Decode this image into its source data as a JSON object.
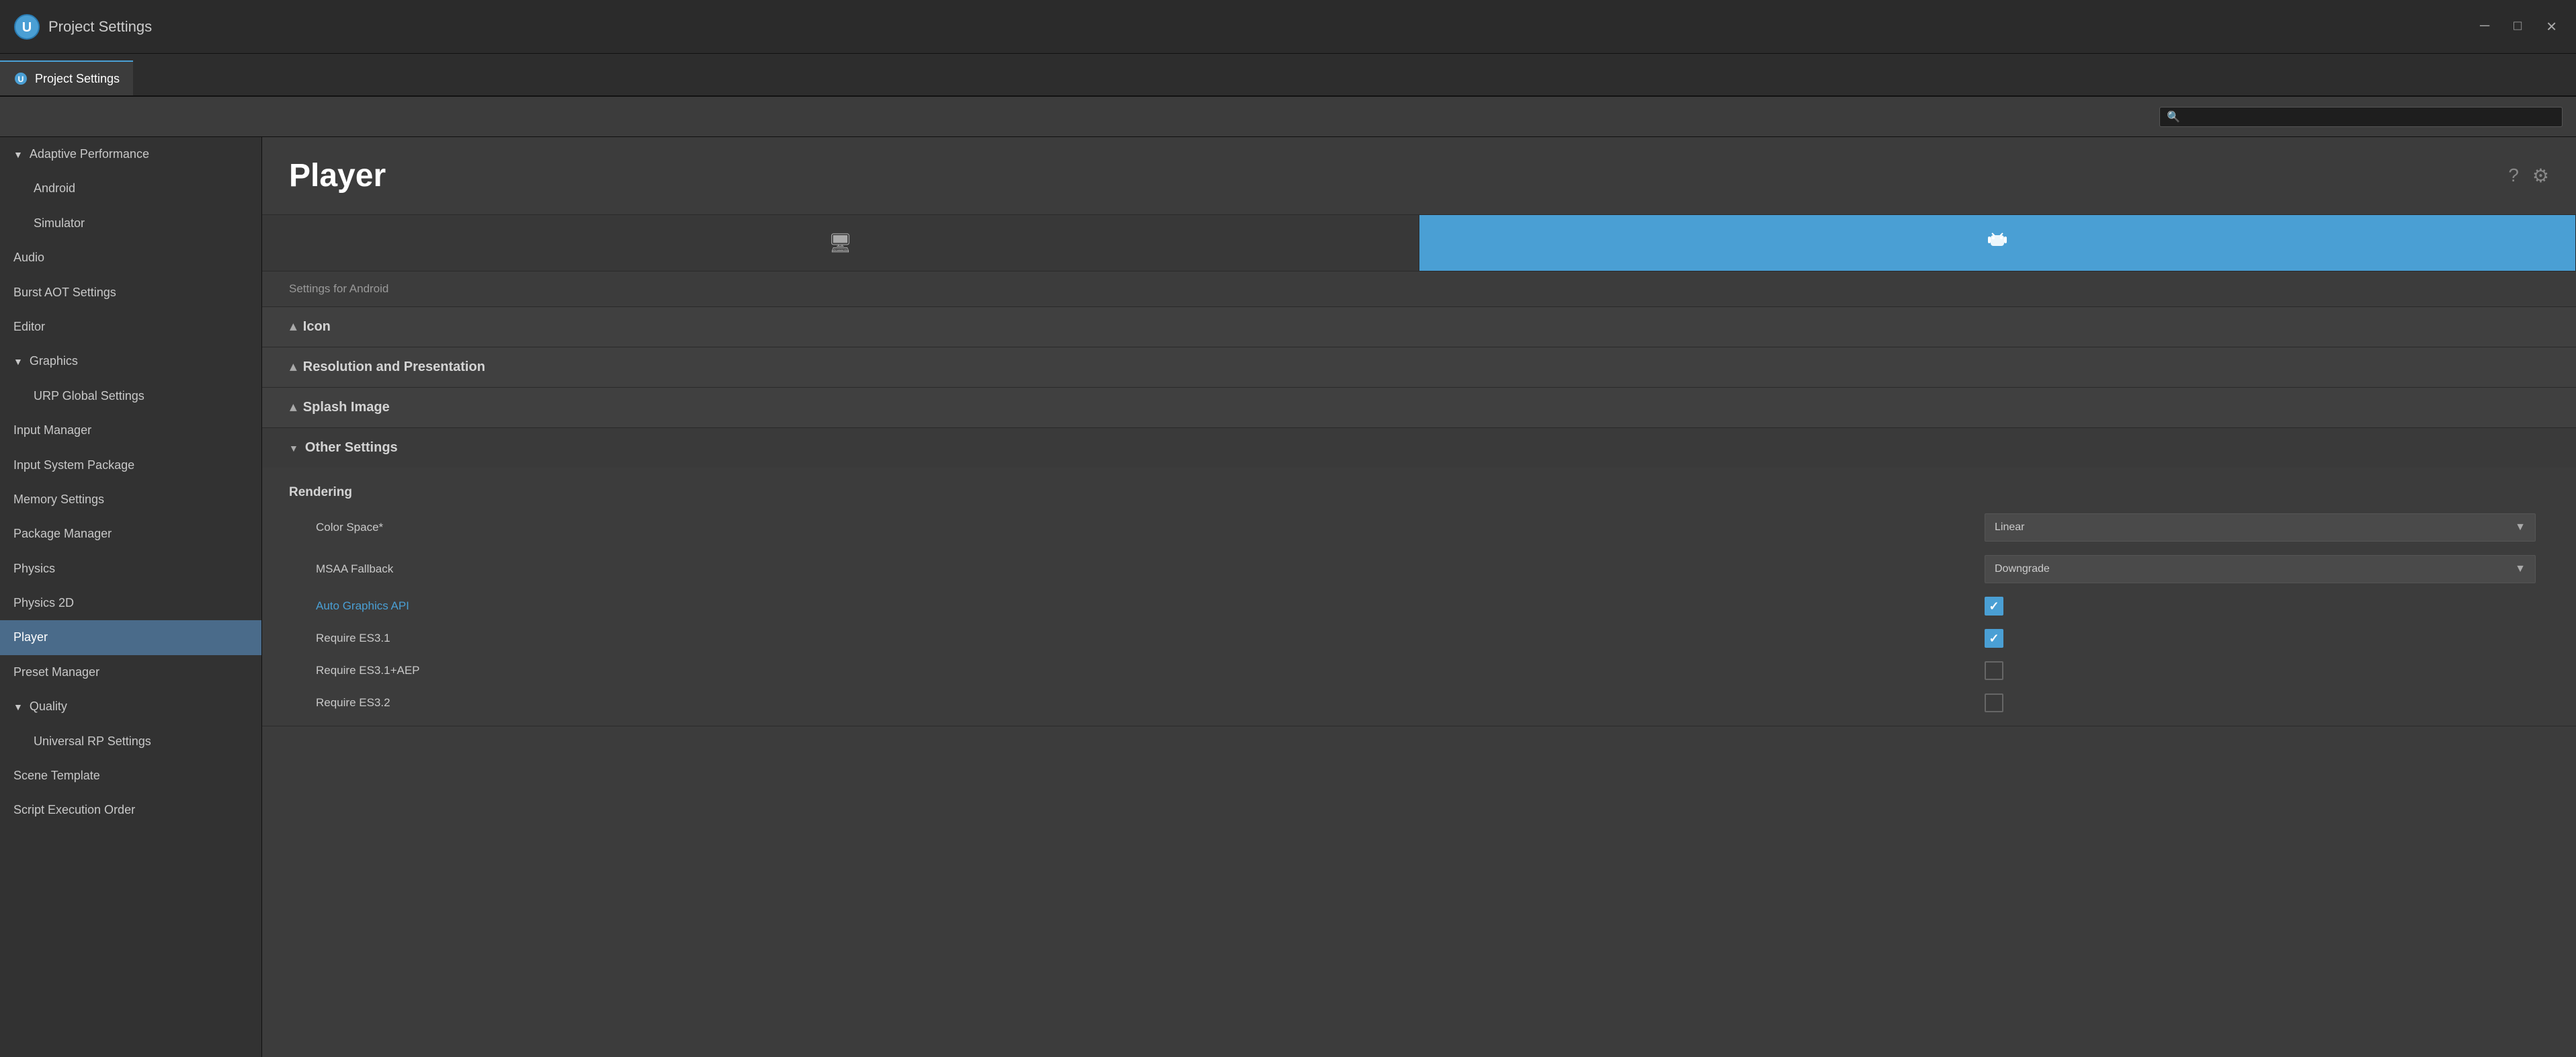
{
  "titleBar": {
    "title": "Project Settings",
    "icon": "gear"
  },
  "windowControls": {
    "minimize": "─",
    "maximize": "□",
    "close": "✕"
  },
  "tabBar": {
    "tabs": [
      {
        "id": "project-settings",
        "label": "Project Settings",
        "active": true
      }
    ]
  },
  "search": {
    "placeholder": ""
  },
  "sidebar": {
    "items": [
      {
        "id": "adaptive-performance",
        "label": "Adaptive Performance",
        "type": "parent-open",
        "level": 0
      },
      {
        "id": "android",
        "label": "Android",
        "type": "child",
        "level": 1
      },
      {
        "id": "simulator",
        "label": "Simulator",
        "type": "child",
        "level": 1
      },
      {
        "id": "audio",
        "label": "Audio",
        "type": "item",
        "level": 0
      },
      {
        "id": "burst-aot-settings",
        "label": "Burst AOT Settings",
        "type": "item",
        "level": 0
      },
      {
        "id": "editor",
        "label": "Editor",
        "type": "item",
        "level": 0
      },
      {
        "id": "graphics",
        "label": "Graphics",
        "type": "parent-open",
        "level": 0
      },
      {
        "id": "urp-global-settings",
        "label": "URP Global Settings",
        "type": "child",
        "level": 1
      },
      {
        "id": "input-manager",
        "label": "Input Manager",
        "type": "item",
        "level": 0
      },
      {
        "id": "input-system-package",
        "label": "Input System Package",
        "type": "item",
        "level": 0
      },
      {
        "id": "memory-settings",
        "label": "Memory Settings",
        "type": "item",
        "level": 0
      },
      {
        "id": "package-manager",
        "label": "Package Manager",
        "type": "item",
        "level": 0
      },
      {
        "id": "physics",
        "label": "Physics",
        "type": "item",
        "level": 0
      },
      {
        "id": "physics-2d",
        "label": "Physics 2D",
        "type": "item",
        "level": 0
      },
      {
        "id": "player",
        "label": "Player",
        "type": "item",
        "level": 0,
        "active": true
      },
      {
        "id": "preset-manager",
        "label": "Preset Manager",
        "type": "item",
        "level": 0
      },
      {
        "id": "quality",
        "label": "Quality",
        "type": "parent-open",
        "level": 0
      },
      {
        "id": "universal-rp-settings",
        "label": "Universal RP Settings",
        "type": "child",
        "level": 1
      },
      {
        "id": "scene-template",
        "label": "Scene Template",
        "type": "item",
        "level": 0
      },
      {
        "id": "script-execution-order",
        "label": "Script Execution Order",
        "type": "item",
        "level": 0
      }
    ]
  },
  "content": {
    "title": "Player",
    "platformTabs": [
      {
        "id": "desktop",
        "icon": "🖥",
        "active": false
      },
      {
        "id": "android",
        "icon": "🤖",
        "active": true
      }
    ],
    "settingsFor": "Settings for Android",
    "sections": [
      {
        "id": "icon",
        "title": "Icon",
        "expanded": false,
        "triangle": "closed"
      },
      {
        "id": "resolution-and-presentation",
        "title": "Resolution and Presentation",
        "expanded": false,
        "triangle": "closed"
      },
      {
        "id": "splash-image",
        "title": "Splash Image",
        "expanded": false,
        "triangle": "closed"
      },
      {
        "id": "other-settings",
        "title": "Other Settings",
        "expanded": true,
        "triangle": "open",
        "subsections": [
          {
            "id": "rendering",
            "title": "Rendering",
            "settings": [
              {
                "id": "color-space",
                "label": "Color Space*",
                "type": "dropdown",
                "value": "Linear",
                "isLink": false
              },
              {
                "id": "msaa-fallback",
                "label": "MSAA Fallback",
                "type": "dropdown",
                "value": "Downgrade",
                "isLink": false
              },
              {
                "id": "auto-graphics-api",
                "label": "Auto Graphics API",
                "type": "checkbox",
                "checked": true,
                "isLink": true
              },
              {
                "id": "require-es31",
                "label": "Require ES3.1",
                "type": "checkbox",
                "checked": true,
                "isLink": false
              },
              {
                "id": "require-es31-aep",
                "label": "Require ES3.1+AEP",
                "type": "checkbox",
                "checked": false,
                "isLink": false
              },
              {
                "id": "require-es32",
                "label": "Require ES3.2",
                "type": "checkbox",
                "checked": false,
                "isLink": false
              }
            ]
          }
        ]
      }
    ]
  },
  "icons": {
    "help": "?",
    "settings": "⚙",
    "search": "🔍",
    "gear": "⚙"
  },
  "colors": {
    "accent": "#4a9fd4",
    "activeTab": "#4a6b8a",
    "sidebar": "#323232",
    "content": "#3c3c3c"
  }
}
